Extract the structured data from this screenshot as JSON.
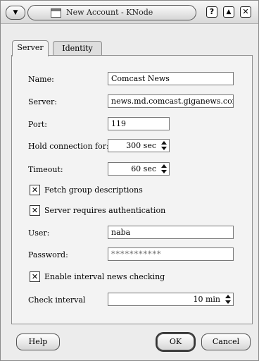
{
  "window": {
    "title": "New Account - KNode",
    "menu_glyph": "▼",
    "help_glyph": "?",
    "maximize_glyph": "▲",
    "close_glyph": "✕"
  },
  "tabs": [
    {
      "label": "Server",
      "active": true
    },
    {
      "label": "Identity",
      "active": false
    }
  ],
  "form": {
    "name_label": "Name:",
    "name_value": "Comcast News",
    "server_label": "Server:",
    "server_value": "news.md.comcast.giganews.com",
    "port_label": "Port:",
    "port_value": "119",
    "hold_label": "Hold connection for:",
    "hold_value": "300 sec",
    "timeout_label": "Timeout:",
    "timeout_value": "60 sec",
    "fetch_desc_label": "Fetch group descriptions",
    "fetch_desc_checked": true,
    "auth_label": "Server requires authentication",
    "auth_checked": true,
    "user_label": "User:",
    "user_value": "naba",
    "password_label": "Password:",
    "password_value": "***********",
    "interval_check_label": "Enable interval news checking",
    "interval_check_checked": true,
    "check_interval_label": "Check interval",
    "check_interval_value": "10 min",
    "check_mark": "✕"
  },
  "buttons": {
    "help": "Help",
    "ok": "OK",
    "cancel": "Cancel"
  }
}
